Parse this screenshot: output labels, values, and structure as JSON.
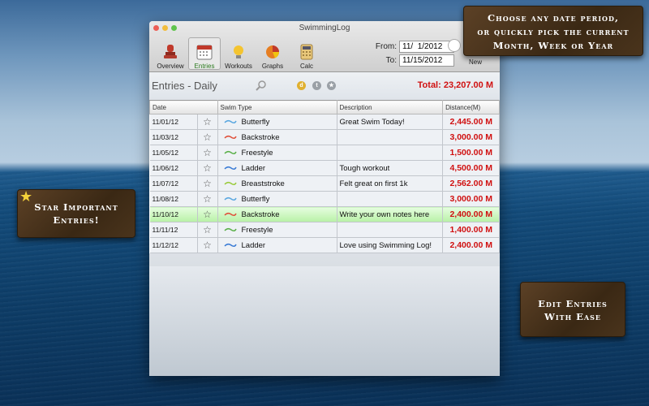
{
  "window": {
    "title": "SwimmingLog"
  },
  "toolbar": {
    "items": [
      {
        "label": "Overview",
        "icon": "stamp-icon"
      },
      {
        "label": "Entries",
        "icon": "calendar-icon"
      },
      {
        "label": "Workouts",
        "icon": "lightbulb-icon"
      },
      {
        "label": "Graphs",
        "icon": "pie-chart-icon"
      },
      {
        "label": "Calc",
        "icon": "calculator-icon"
      }
    ],
    "new_label": "New"
  },
  "date_filter": {
    "from_label": "From:",
    "from_value": "11/  1/2012",
    "to_label": "To:",
    "to_value": "11/15/2012"
  },
  "entries": {
    "title": "Entries - Daily",
    "filter_buttons": [
      "d",
      "t",
      "★"
    ],
    "total": "Total: 23,207.00 M"
  },
  "table": {
    "headers": [
      "Date",
      "Swim Type",
      "Description",
      "Distance(M)"
    ],
    "rows": [
      {
        "date": "11/01/12",
        "star": "☆",
        "type": "Butterfly",
        "stroke_color": "#5aa7e0",
        "description": "Great Swim Today!",
        "distance": "2,445.00 M",
        "selected": false
      },
      {
        "date": "11/03/12",
        "star": "☆",
        "type": "Backstroke",
        "stroke_color": "#e0503a",
        "description": "",
        "distance": "3,000.00 M",
        "selected": false
      },
      {
        "date": "11/05/12",
        "star": "☆",
        "type": "Freestyle",
        "stroke_color": "#5bb04a",
        "description": "",
        "distance": "1,500.00 M",
        "selected": false
      },
      {
        "date": "11/06/12",
        "star": "☆",
        "type": "Ladder",
        "stroke_color": "#3a7bd5",
        "description": "Tough workout",
        "distance": "4,500.00 M",
        "selected": false
      },
      {
        "date": "11/07/12",
        "star": "☆",
        "type": "Breaststroke",
        "stroke_color": "#9acb3c",
        "description": "Felt great on first 1k",
        "distance": "2,562.00 M",
        "selected": false
      },
      {
        "date": "11/08/12",
        "star": "☆",
        "type": "Butterfly",
        "stroke_color": "#5aa7e0",
        "description": "",
        "distance": "3,000.00 M",
        "selected": false
      },
      {
        "date": "11/10/12",
        "star": "☆",
        "type": "Backstroke",
        "stroke_color": "#e0503a",
        "description": "Write your own notes here",
        "distance": "2,400.00 M",
        "selected": true
      },
      {
        "date": "11/11/12",
        "star": "☆",
        "type": "Freestyle",
        "stroke_color": "#5bb04a",
        "description": "",
        "distance": "1,400.00 M",
        "selected": false
      },
      {
        "date": "11/12/12",
        "star": "☆",
        "type": "Ladder",
        "stroke_color": "#3a7bd5",
        "description": "Love using Swimming Log!",
        "distance": "2,400.00 M",
        "selected": false
      }
    ]
  },
  "callouts": {
    "top": [
      "Choose any date period,",
      "or quickly pick the current",
      "Month, Week or Year"
    ],
    "left": [
      "Star Important",
      "Entries!"
    ],
    "right": [
      "Edit Entries",
      "With Ease"
    ]
  },
  "colors": {
    "total_red": "#d01010",
    "selected_row": "#b8f1a6",
    "callout_bg": "#3a2814"
  }
}
